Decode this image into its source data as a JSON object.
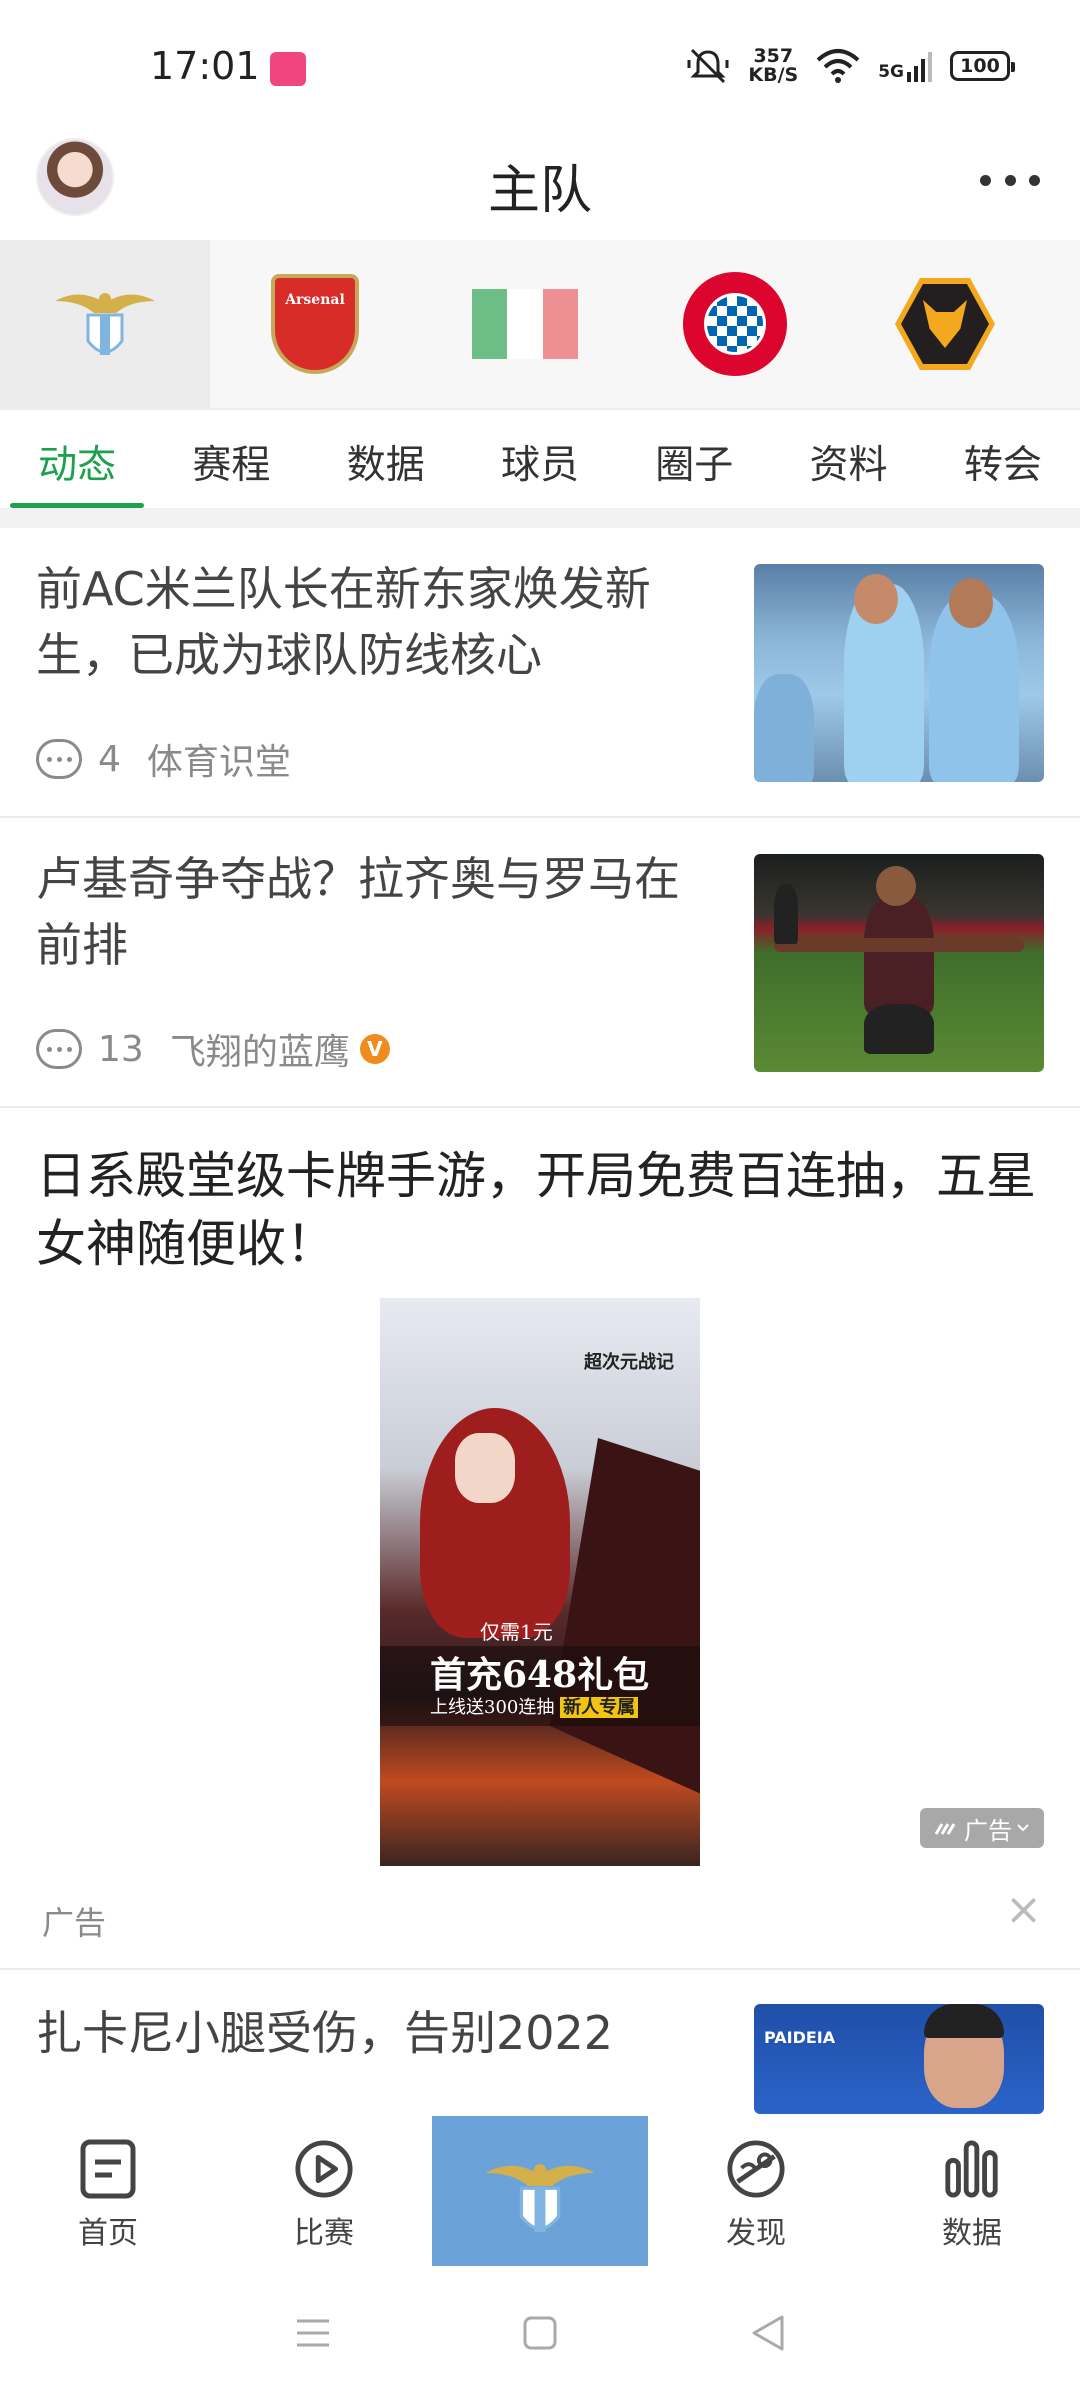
{
  "status_bar": {
    "time": "17:01",
    "net_speed_value": "357",
    "net_speed_unit": "KB/S",
    "network": "5G",
    "battery": "100"
  },
  "header": {
    "title": "主队"
  },
  "teams": [
    {
      "name": "Lazio",
      "active": true
    },
    {
      "name": "Arsenal",
      "active": false
    },
    {
      "name": "Italy",
      "active": false
    },
    {
      "name": "FC Bayern München",
      "active": false
    },
    {
      "name": "Wolves",
      "active": false
    }
  ],
  "team_logo_text": {
    "arsenal": "Arsenal"
  },
  "tabs": [
    {
      "label": "动态",
      "active": true
    },
    {
      "label": "赛程",
      "active": false
    },
    {
      "label": "数据",
      "active": false
    },
    {
      "label": "球员",
      "active": false
    },
    {
      "label": "圈子",
      "active": false
    },
    {
      "label": "资料",
      "active": false
    },
    {
      "label": "转会",
      "active": false
    }
  ],
  "feed": {
    "items": [
      {
        "title": "前AC米兰队长在新东家焕发新生，已成为球队防线核心",
        "comments": "4",
        "source": "体育识堂",
        "verified": false
      },
      {
        "title": "卢基奇争夺战？拉齐奥与罗马在前排",
        "comments": "13",
        "source": "飞翔的蓝鹰",
        "verified": true,
        "verified_mark": "V"
      },
      {
        "title": "扎卡尼小腿受伤，告别2022"
      }
    ],
    "ad": {
      "title": "日系殿堂级卡牌手游，开局免费百连抽，五星女神随便收！",
      "image_text": {
        "game_logo": "超次元战记",
        "small": "仅需1元",
        "big": "首充648礼包",
        "sub_prefix": "上线送300连抽",
        "sub_highlight": "新人专属"
      },
      "chip_label": "广告",
      "label": "广告",
      "close": "×"
    }
  },
  "bottom_nav": [
    {
      "label": "首页",
      "icon": "home-doc-icon"
    },
    {
      "label": "比赛",
      "icon": "play-icon"
    },
    {
      "label": "",
      "icon": "lazio-logo-icon"
    },
    {
      "label": "发现",
      "icon": "discover-icon"
    },
    {
      "label": "数据",
      "icon": "bar-chart-icon"
    }
  ],
  "colors": {
    "accent": "#1ea14e",
    "center_tab": "#6ba3d8",
    "verified": "#ef8c1f"
  }
}
